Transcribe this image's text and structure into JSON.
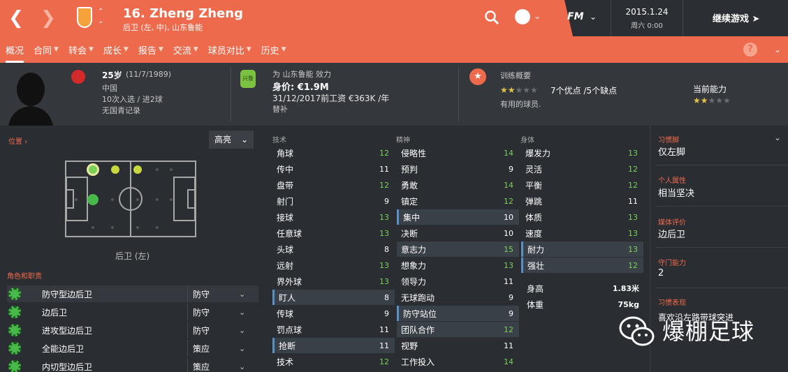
{
  "header": {
    "title": "16. Zheng Zheng",
    "subtitle": "后卫 (左, 中), 山东鲁能",
    "date": "2015.1.24",
    "time": "周六 0:00",
    "logo": "FM",
    "continue_label": "继续游戏"
  },
  "tabs": [
    {
      "label": "概况"
    },
    {
      "label": "合同"
    },
    {
      "label": "转会"
    },
    {
      "label": "成长"
    },
    {
      "label": "报告"
    },
    {
      "label": "交流"
    },
    {
      "label": "球员对比"
    },
    {
      "label": "历史"
    }
  ],
  "help_label": "?",
  "info": {
    "age": "25岁",
    "dob": "(11/7/1989)",
    "nation": "中国",
    "caps": "10次入选 / 进2球",
    "youth": "无国青记录",
    "club_line": "为 山东鲁能 效力",
    "club_badge": "兴鲁",
    "value": "身价: €1.9M",
    "wage": "31/12/2017前工资 €363K /年",
    "squad_status": "替补",
    "training_title": "训练概要",
    "training_stars": 2,
    "traits": "7个优点 /5个缺点",
    "traits_note": "有用的球员.",
    "ability_title": "当前能力",
    "ability_stars": 2
  },
  "left": {
    "position_label": "位置",
    "highlight_option": "高亮",
    "position_text": "后卫 (左)",
    "roles_label": "角色和职责",
    "roles": [
      {
        "name": "防守型边后卫",
        "duty": "防守"
      },
      {
        "name": "边后卫",
        "duty": "防守"
      },
      {
        "name": "进攻型边后卫",
        "duty": "防守"
      },
      {
        "name": "全能边后卫",
        "duty": "策应"
      },
      {
        "name": "内切型边后卫",
        "duty": "策应"
      }
    ]
  },
  "attributes": {
    "technical_title": "技术",
    "mental_title": "精神",
    "physical_title": "身体",
    "technical": [
      {
        "name": "角球",
        "value": 12
      },
      {
        "name": "传中",
        "value": 11
      },
      {
        "name": "盘带",
        "value": 12
      },
      {
        "name": "射门",
        "value": 9
      },
      {
        "name": "接球",
        "value": 13
      },
      {
        "name": "任意球",
        "value": 13
      },
      {
        "name": "头球",
        "value": 8
      },
      {
        "name": "远射",
        "value": 13
      },
      {
        "name": "界外球",
        "value": 13
      },
      {
        "name": "盯人",
        "value": 8
      },
      {
        "name": "传球",
        "value": 9
      },
      {
        "name": "罚点球",
        "value": 11
      },
      {
        "name": "抢断",
        "value": 11
      },
      {
        "name": "技术",
        "value": 12
      }
    ],
    "mental": [
      {
        "name": "侵略性",
        "value": 14
      },
      {
        "name": "预判",
        "value": 9
      },
      {
        "name": "勇敢",
        "value": 14
      },
      {
        "name": "镇定",
        "value": 12
      },
      {
        "name": "集中",
        "value": 10
      },
      {
        "name": "决断",
        "value": 10
      },
      {
        "name": "意志力",
        "value": 15
      },
      {
        "name": "想象力",
        "value": 13
      },
      {
        "name": "领导力",
        "value": 11
      },
      {
        "name": "无球跑动",
        "value": 9
      },
      {
        "name": "防守站位",
        "value": 9
      },
      {
        "name": "团队合作",
        "value": 12
      },
      {
        "name": "视野",
        "value": 11
      },
      {
        "name": "工作投入",
        "value": 14
      }
    ],
    "physical": [
      {
        "name": "爆发力",
        "value": 13
      },
      {
        "name": "灵活",
        "value": 12
      },
      {
        "name": "平衡",
        "value": 12
      },
      {
        "name": "弹跳",
        "value": 11
      },
      {
        "name": "体质",
        "value": 13
      },
      {
        "name": "速度",
        "value": 13
      },
      {
        "name": "耐力",
        "value": 13
      },
      {
        "name": "强壮",
        "value": 12
      }
    ],
    "height_label": "身高",
    "height": "1.83米",
    "weight_label": "体重",
    "weight": "75kg"
  },
  "right": {
    "foot_label": "习惯脚",
    "foot": "仅左脚",
    "personality_label": "个人属性",
    "personality": "相当坚决",
    "media_label": "媒体评价",
    "media": "边后卫",
    "keeper_label": "守门能力",
    "keeper": "2",
    "habits_label": "习惯表现",
    "habits": "喜欢沿左路带球突进"
  },
  "watermark": "爆棚足球",
  "colors": {
    "accent": "#ee6a4c",
    "green": "#7bd05a",
    "background": "#2a2d32"
  }
}
